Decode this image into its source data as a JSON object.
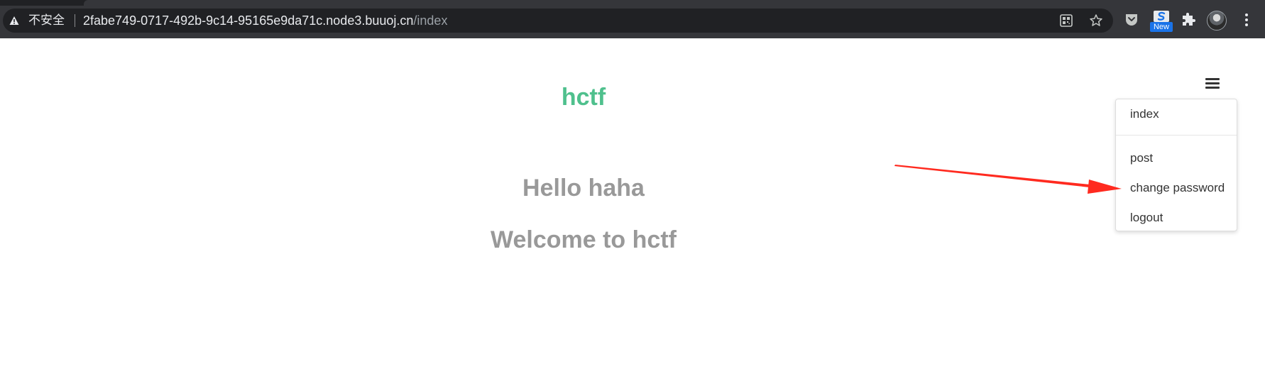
{
  "browser": {
    "security_label": "不安全",
    "url_host": "2fabe749-0717-492b-9c14-95165e9da71c.node3.buuoj.cn",
    "url_path": "/index",
    "new_badge": "New",
    "icons": [
      "warning-icon",
      "qr-code-icon",
      "bookmark-star-icon",
      "pocket-extension-icon",
      "new-extension-icon",
      "extensions-puzzle-icon",
      "profile-avatar",
      "menu-kebab-icon"
    ]
  },
  "page": {
    "site_title": "hctf",
    "greeting": "Hello haha",
    "welcome": "Welcome to hctf"
  },
  "menu": {
    "items": [
      "index",
      "post",
      "change password",
      "logout"
    ]
  },
  "colors": {
    "brand": "#4fc08d",
    "heading": "#999999",
    "annotation": "#ff2a1f",
    "chrome": "#35363a"
  }
}
